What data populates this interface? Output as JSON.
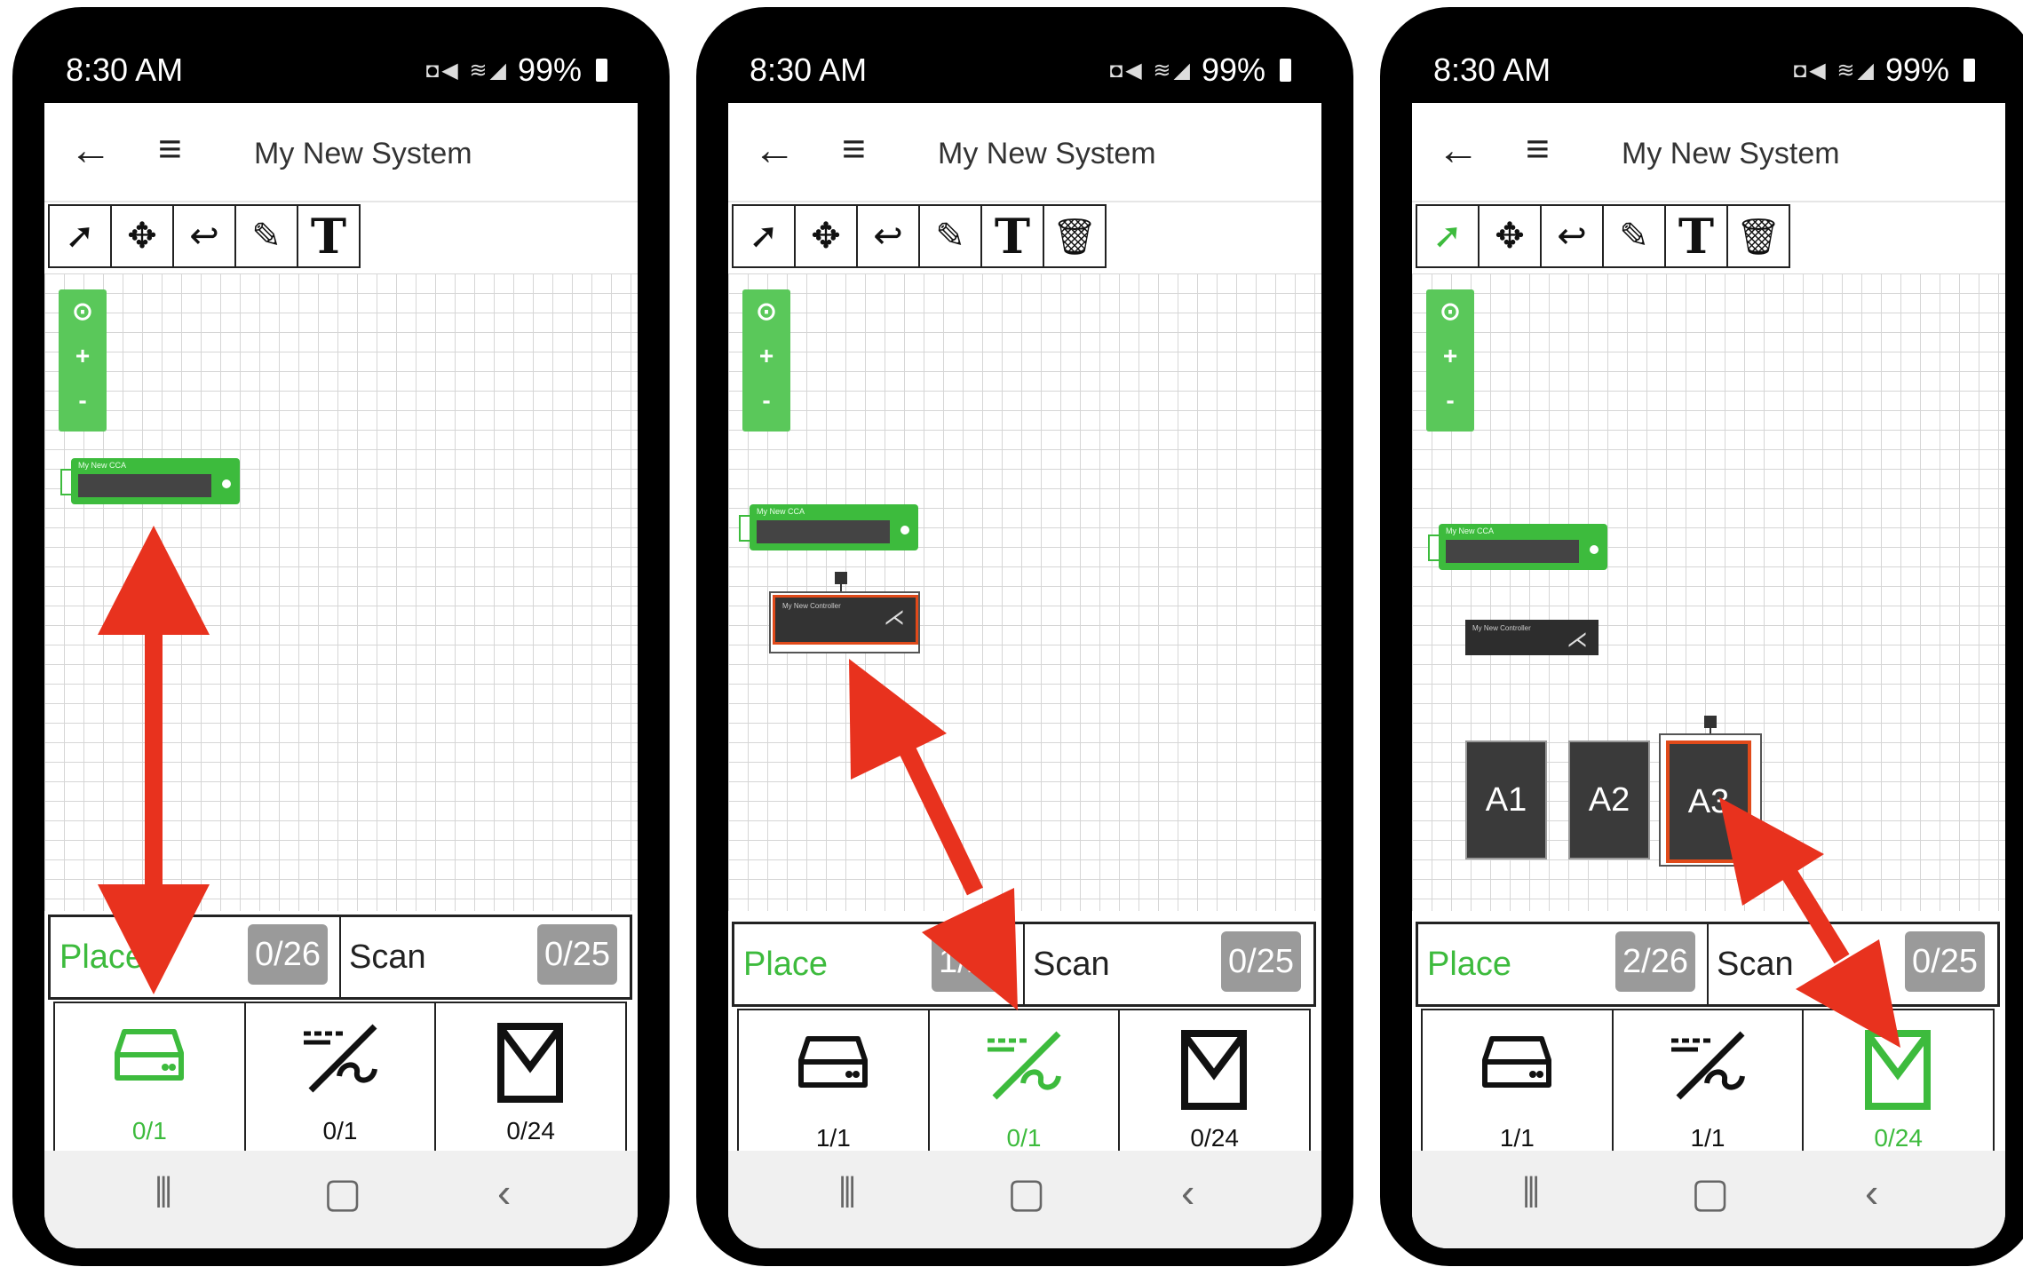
{
  "status": {
    "time": "8:30 AM",
    "battery": "99%"
  },
  "app": {
    "title": "My New System"
  },
  "tools": {
    "select": "select-tool",
    "move": "move-tool",
    "undo": "undo-tool",
    "draw": "pencil-tool",
    "text_glyph": "T",
    "delete": "trash-tool"
  },
  "zoom": {
    "center": "⊙",
    "plus": "+",
    "minus": "-"
  },
  "devices": {
    "cca_label": "My New CCA",
    "controller_label": "My New Controller"
  },
  "zones": [
    "A1",
    "A2",
    "A3"
  ],
  "panels": [
    {
      "place_label": "Place",
      "place_count": "0/26",
      "scan_label": "Scan",
      "scan_count": "0/25",
      "categories": [
        {
          "icon": "drive-icon",
          "count": "0/1"
        },
        {
          "icon": "controller-icon",
          "count": "0/1"
        },
        {
          "icon": "zone-icon",
          "count": "0/24"
        }
      ]
    },
    {
      "place_label": "Place",
      "place_count": "1/26",
      "scan_label": "Scan",
      "scan_count": "0/25",
      "categories": [
        {
          "icon": "drive-icon",
          "count": "1/1"
        },
        {
          "icon": "controller-icon",
          "count": "0/1"
        },
        {
          "icon": "zone-icon",
          "count": "0/24"
        }
      ]
    },
    {
      "place_label": "Place",
      "place_count": "2/26",
      "scan_label": "Scan",
      "scan_count": "0/25",
      "categories": [
        {
          "icon": "drive-icon",
          "count": "1/1"
        },
        {
          "icon": "controller-icon",
          "count": "1/1"
        },
        {
          "icon": "zone-icon",
          "count": "0/24"
        }
      ]
    }
  ],
  "colors": {
    "accent_green": "#3dbb3d",
    "arrow_red": "#e8321e",
    "selection_orange": "#e04a1a"
  }
}
